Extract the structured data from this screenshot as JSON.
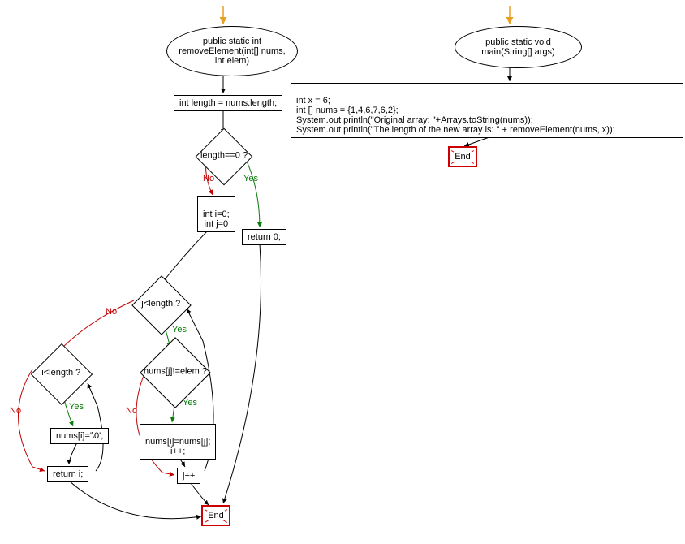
{
  "flowchart_left": {
    "start": "public static int removeElement(int[] nums, int elem)",
    "stmt_length": "int length = nums.length;",
    "cond_length0": "length==0 ?",
    "branch_no_1": "No",
    "branch_yes_1": "Yes",
    "stmt_init": "int i=0;\nint j=0",
    "stmt_return0": "return 0;",
    "cond_jlt": "j<length ?",
    "branch_no_2": "No",
    "branch_yes_2": "Yes",
    "cond_ilt": "i<length ?",
    "cond_numsj": "nums[j]!=elem ?",
    "branch_yes_3": "Yes",
    "branch_no_3": "No",
    "branch_yes_4": "Yes",
    "branch_no_4": "No",
    "stmt_numsi0": "nums[i]='\\0';",
    "stmt_copy": "nums[i]=nums[j];\ni++;",
    "stmt_jpp": "j++",
    "stmt_returni": "return i;",
    "end": "End"
  },
  "flowchart_right": {
    "start": "public static void main(String[] args)",
    "body": "int x = 6;\nint [] nums = {1,4,6,7,6,2};\nSystem.out.println(\"Original array: \"+Arrays.toString(nums));\nSystem.out.println(\"The length of the new array is:  \" + removeElement(nums, x));",
    "end": "End"
  },
  "colors": {
    "entry_arrow": "#e8a020",
    "yes": "#0a7a0a",
    "no": "#c00000",
    "edge": "#000000",
    "end_border": "#c00000"
  }
}
